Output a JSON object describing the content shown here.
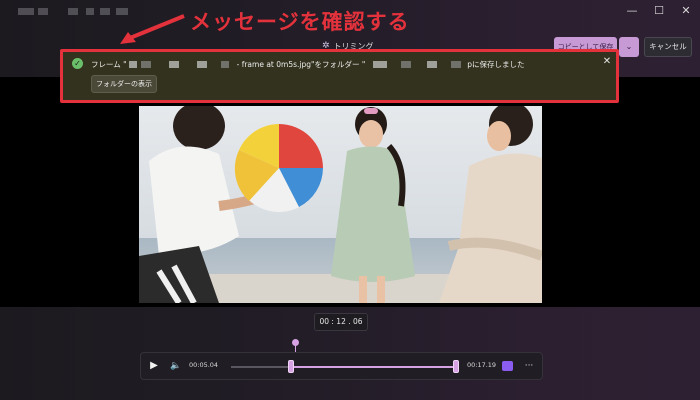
{
  "window": {
    "controls": {
      "minimize": "—",
      "maximize": "☐",
      "close": "✕"
    }
  },
  "header": {
    "title": "トリミング",
    "title_icon": "sparkle-icon",
    "save_label": "コピーとして保存",
    "save_dropdown": "⌄",
    "cancel_label": "キャンセル",
    "accent_color": "#c79ad6"
  },
  "annotation": {
    "text": "メッセージを確認する",
    "color": "#e4323c"
  },
  "notification": {
    "icon": "check-circle-icon",
    "msg_prefix": "フレーム \"",
    "msg_middle": "- frame at 0m5s.jpg\"をフォルダー \"",
    "msg_suffix": "pに保存しました",
    "close": "✕",
    "folder_button": "フォルダーの表示",
    "background": "#33321e"
  },
  "player": {
    "timecode": "00 : 12 . 06",
    "start_time": "00:05.04",
    "end_time": "00:17.19",
    "play": "▶",
    "volume": "🔈",
    "more": "···"
  }
}
